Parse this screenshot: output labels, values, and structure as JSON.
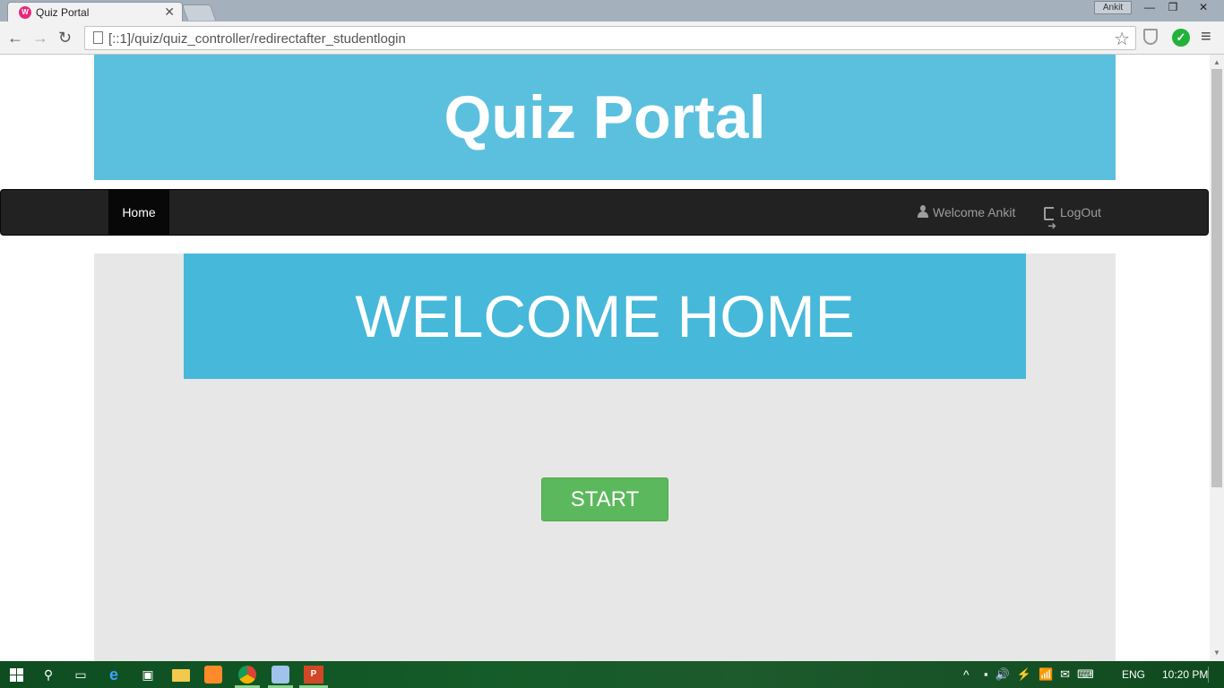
{
  "browser": {
    "tab_title": "Quiz Portal",
    "tab_close": "✕",
    "profile_name": "Ankit",
    "url": "[::1]/quiz/quiz_controller/redirectafter_studentlogin",
    "icons": {
      "back": "←",
      "forward": "→",
      "reload": "↻",
      "star": "☆",
      "check": "✓",
      "menu": "≡",
      "minimize": "—",
      "maximize": "❐",
      "close": "✕"
    }
  },
  "page": {
    "site_title": "Quiz Portal",
    "nav": {
      "home_label": "Home",
      "welcome_label": "Welcome Ankit",
      "logout_label": "LogOut"
    },
    "welcome_heading": "WELCOME HOME",
    "start_button_label": "START"
  },
  "colors": {
    "header_bg": "#5bc0de",
    "banner_bg": "#46b8da",
    "navbar_bg": "#222222",
    "jumbotron_bg": "#e7e7e7",
    "start_button_bg": "#5cb85c"
  },
  "taskbar": {
    "language": "ENG",
    "time": "10:20 PM",
    "ppt_label": "P"
  }
}
